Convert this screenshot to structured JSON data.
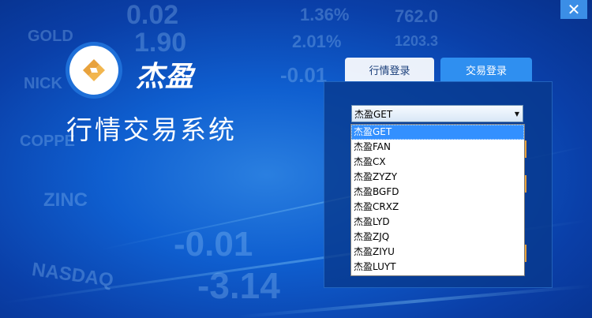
{
  "window": {
    "close_label": "✕"
  },
  "brand": {
    "name": "杰盈",
    "title": "行情交易系统",
    "logo_icon": "jieying-logo-icon"
  },
  "background": {
    "tickers": [
      "0.02",
      "1.36%",
      "762.0",
      "GOLD",
      "1.90",
      "2.01%",
      "1203.3",
      "NICK",
      "-0.01",
      "COPPE",
      "ZINC",
      "-0.01",
      "NASDAQ",
      "-3.14"
    ]
  },
  "tabs": [
    {
      "label": "行情登录",
      "active": false
    },
    {
      "label": "交易登录",
      "active": true
    }
  ],
  "server_select": {
    "value": "杰盈GET",
    "options": [
      "杰盈GET",
      "杰盈FAN",
      "杰盈CX",
      "杰盈ZYZY",
      "杰盈BGFD",
      "杰盈CRXZ",
      "杰盈LYD",
      "杰盈ZJQ",
      "杰盈ZIYU",
      "杰盈LUYT"
    ],
    "selected_index": 0
  },
  "colors": {
    "accent": "#2f8ff0",
    "selection": "#3390ff",
    "logo_gold": "#e8a23c",
    "logo_ring": "#1e6fd8"
  }
}
